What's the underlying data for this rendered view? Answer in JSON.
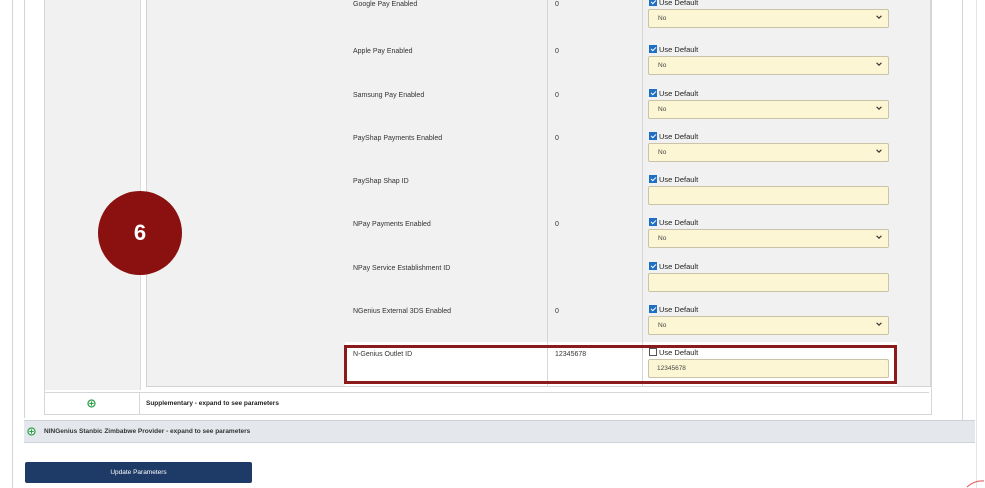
{
  "rows": [
    {
      "label": "Google Pay Enabled",
      "value": "0",
      "use_default_label": "Use Default",
      "use_default": true,
      "control": "select",
      "control_value": "No"
    },
    {
      "label": "Apple Pay Enabled",
      "value": "0",
      "use_default_label": "Use Default",
      "use_default": true,
      "control": "select",
      "control_value": "No"
    },
    {
      "label": "Samsung Pay Enabled",
      "value": "0",
      "use_default_label": "Use Default",
      "use_default": true,
      "control": "select",
      "control_value": "No"
    },
    {
      "label": "PayShap Payments Enabled",
      "value": "0",
      "use_default_label": "Use Default",
      "use_default": true,
      "control": "select",
      "control_value": "No"
    },
    {
      "label": "PayShap Shap ID",
      "value": "",
      "use_default_label": "Use Default",
      "use_default": true,
      "control": "input",
      "control_value": ""
    },
    {
      "label": "NPay Payments Enabled",
      "value": "0",
      "use_default_label": "Use Default",
      "use_default": true,
      "control": "select",
      "control_value": "No"
    },
    {
      "label": "NPay Service Establishment ID",
      "value": "",
      "use_default_label": "Use Default",
      "use_default": true,
      "control": "input",
      "control_value": ""
    },
    {
      "label": "NGenius External 3DS Enabled",
      "value": "0",
      "use_default_label": "Use Default",
      "use_default": true,
      "control": "select",
      "control_value": "No"
    },
    {
      "label": "N-Genius Outlet ID",
      "value": "12345678",
      "use_default_label": "Use Default",
      "use_default": false,
      "control": "input",
      "control_value": "12345678"
    }
  ],
  "step_badge": "6",
  "supplementary": {
    "label": "Supplementary - expand to see parameters"
  },
  "provider": {
    "label": "NINGenius Stanbic Zimbabwe Provider - expand to see parameters"
  },
  "update_button": {
    "label": "Update Parameters"
  },
  "colors": {
    "highlight": "#8b1a1a",
    "badge": "#8b1111",
    "button": "#1e3a66",
    "field_bg": "#fdf6d4",
    "expand_icon": "#2fa04a"
  }
}
